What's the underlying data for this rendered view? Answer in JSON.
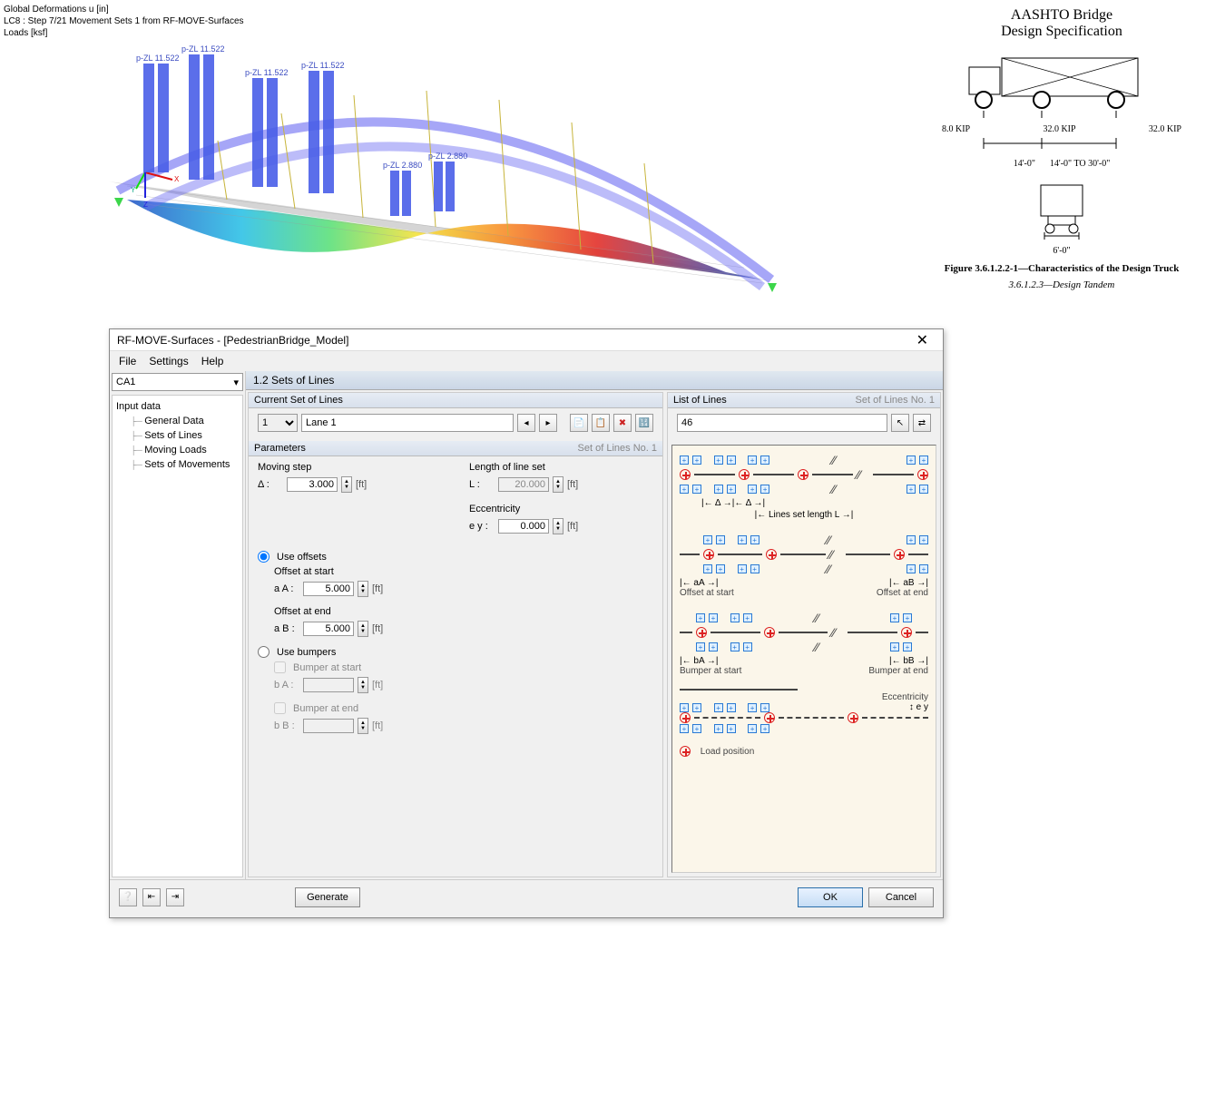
{
  "viewer": {
    "line1": "Global Deformations u [in]",
    "line2": "LC8 : Step 7/21 Movement Sets 1 from RF-MOVE-Surfaces",
    "line3": "Loads [ksf]",
    "load_labels": {
      "a": "p-ZL 11.522",
      "b": "p-ZL 11.522",
      "c": "p-ZL 11.522",
      "d": "p-ZL 11.522",
      "e": "p-ZL 2.880",
      "f": "p-ZL 2.880"
    }
  },
  "spec": {
    "title1": "AASHTO Bridge",
    "title2": "Design Specification",
    "axle1": "8.0 KIP",
    "axle2": "32.0 KIP",
    "axle3": "32.0 KIP",
    "spacing1": "14'-0\"",
    "spacing2": "14'-0\" TO 30'-0\"",
    "rear_width": "6'-0\"",
    "figcap": "Figure 3.6.1.2.2-1—Characteristics of the Design Truck",
    "tandem": "3.6.1.2.3—Design Tandem"
  },
  "dialog": {
    "title": "RF-MOVE-Surfaces - [PedestrianBridge_Model]",
    "menu": {
      "file": "File",
      "settings": "Settings",
      "help": "Help"
    },
    "nav": {
      "combo": "CA1",
      "root": "Input data",
      "items": [
        "General Data",
        "Sets of Lines",
        "Moving Loads",
        "Sets of Movements"
      ]
    },
    "section_hdr": "1.2 Sets of Lines",
    "current_set": {
      "title": "Current Set of Lines",
      "number": "1",
      "name": "Lane 1"
    },
    "list_lines": {
      "title": "List of Lines",
      "right": "Set of Lines No. 1",
      "value": "46"
    },
    "params": {
      "title": "Parameters",
      "right": "Set of Lines No. 1",
      "moving_step_lbl": "Moving step",
      "delta_sym": "Δ :",
      "delta_val": "3.000",
      "len_lbl": "Length of line set",
      "len_sym": "L :",
      "len_val": "20.000",
      "ecc_lbl": "Eccentricity",
      "ecc_sym": "e y :",
      "ecc_val": "0.000",
      "ft": "[ft]",
      "use_offsets": "Use offsets",
      "off_start": "Offset at start",
      "aA": "a A :",
      "aA_val": "5.000",
      "off_end": "Offset at end",
      "aB": "a B :",
      "aB_val": "5.000",
      "use_bumpers": "Use bumpers",
      "bmp_start": "Bumper at start",
      "bA": "b A :",
      "bmp_end": "Bumper at end",
      "bB": "b B :"
    },
    "preview": {
      "lines_len": "Lines set length L",
      "delta": "Δ",
      "aA": "aA",
      "offstart": "Offset at start",
      "aB": "aB",
      "offend": "Offset at end",
      "bA": "bA",
      "bmpstart": "Bumper at start",
      "bB": "bB",
      "bmpend": "Bumper at end",
      "ecc": "Eccentricity",
      "ey": "e y",
      "loadpos": "Load position"
    },
    "footer": {
      "generate": "Generate",
      "ok": "OK",
      "cancel": "Cancel"
    }
  }
}
